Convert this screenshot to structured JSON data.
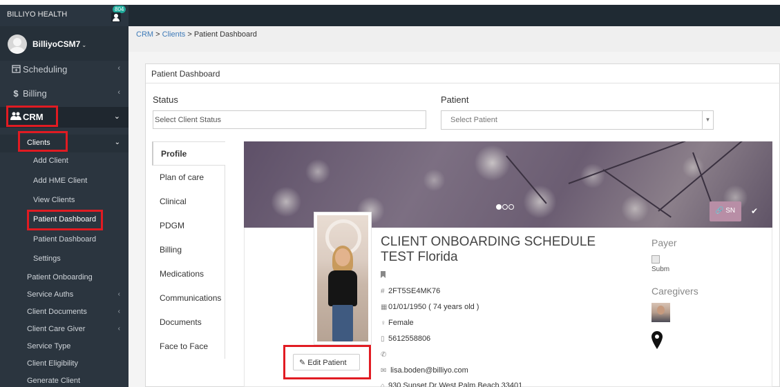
{
  "app": {
    "brand": "BILLIYO HEALTH",
    "notification_badge": "804"
  },
  "user": {
    "name": "BilliyoCSM7"
  },
  "sidebar": {
    "items": [
      {
        "label": "Scheduling",
        "icon": "calendar-plus-icon"
      },
      {
        "label": "Billing",
        "icon": "dollar-icon"
      },
      {
        "label": "CRM",
        "icon": "users-icon"
      }
    ],
    "clients": {
      "label": "Clients",
      "sub": [
        "Add Client",
        "Add HME Client",
        "View Clients",
        "Patient Dashboard",
        "Patient Dashboard",
        "Settings"
      ]
    },
    "crm_items": [
      {
        "label": "Patient Onboarding",
        "chev": false
      },
      {
        "label": "Service Auths",
        "chev": true
      },
      {
        "label": "Client Documents",
        "chev": true
      },
      {
        "label": "Client Care Giver",
        "chev": true
      },
      {
        "label": "Service Type",
        "chev": false
      },
      {
        "label": "Client Eligibility",
        "chev": false
      },
      {
        "label": "Generate Client",
        "chev": false
      }
    ]
  },
  "breadcrumb": {
    "crm": "CRM",
    "clients": "Clients",
    "sep": ">",
    "current": "Patient Dashboard"
  },
  "panel": {
    "title": "Patient Dashboard"
  },
  "filters": {
    "status_label": "Status",
    "status_placeholder": "Select Client Status",
    "patient_label": "Patient",
    "patient_placeholder": "Select Patient"
  },
  "tabs": [
    "Profile",
    "Plan of care",
    "Clinical",
    "PDGM",
    "Billing",
    "Medications",
    "Communications",
    "Documents",
    "Face to Face"
  ],
  "profile": {
    "name": "CLIENT ONBOARDING SCHEDULE TEST Florida",
    "id": "2FT5SE4MK76",
    "dob": "01/01/1950 ( 74 years old )",
    "gender": "Female",
    "phone": "5612558806",
    "email": "lisa.boden@billiyo.com",
    "address": "930 Sunset Dr West Palm Beach 33401",
    "edit_button": "Edit Patient",
    "sn_button": "SN"
  },
  "side": {
    "payer": "Payer",
    "submit_alt": "Subm",
    "caregivers": "Caregivers"
  },
  "colors": {
    "highlight": "#e11b22",
    "sidebar": "#2b353f",
    "link": "#3d7ab8",
    "sn_button": "#b88ea6"
  }
}
